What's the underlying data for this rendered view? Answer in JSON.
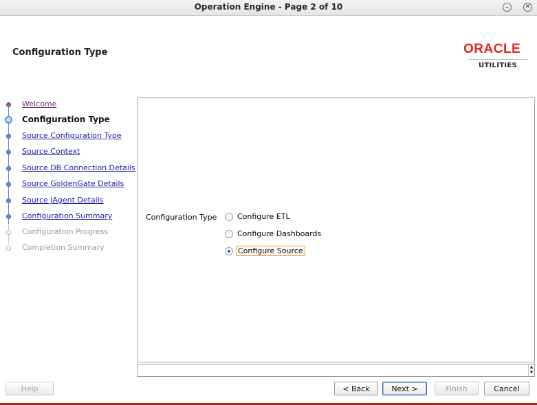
{
  "window": {
    "title": "Operation Engine - Page 2 of 10",
    "minimize_glyph": "⌄",
    "close_glyph": "✕"
  },
  "header": {
    "page_title": "Configuration Type",
    "brand_word": "ORACLE",
    "brand_sub": "UTILITIES"
  },
  "steps": [
    {
      "label": "Welcome",
      "state": "visited"
    },
    {
      "label": "Configuration Type",
      "state": "current"
    },
    {
      "label": "Source Configuration Type",
      "state": "link"
    },
    {
      "label": "Source Context",
      "state": "link"
    },
    {
      "label": "Source DB Connection Details",
      "state": "link"
    },
    {
      "label": "Source GoldenGate Details",
      "state": "link"
    },
    {
      "label": "Source JAgent Details",
      "state": "link"
    },
    {
      "label": "Configuration Summary",
      "state": "link"
    },
    {
      "label": "Configuration Progress",
      "state": "disabled"
    },
    {
      "label": "Completion Summary",
      "state": "disabled"
    }
  ],
  "form": {
    "field_label": "Configuration Type",
    "options": [
      {
        "label": "Configure ETL",
        "checked": false
      },
      {
        "label": "Configure Dashboards",
        "checked": false
      },
      {
        "label": "Configure Source",
        "checked": true
      }
    ]
  },
  "buttons": {
    "help": "Help",
    "back": "< Back",
    "next": "Next >",
    "finish": "Finish",
    "cancel": "Cancel"
  },
  "colors": {
    "accent_blue": "#5a8fd3",
    "link_blue": "#1a1aa6",
    "visited_purple": "#6a2a72",
    "brand_red": "#e0261b",
    "focus_orange": "#f0a01e"
  }
}
